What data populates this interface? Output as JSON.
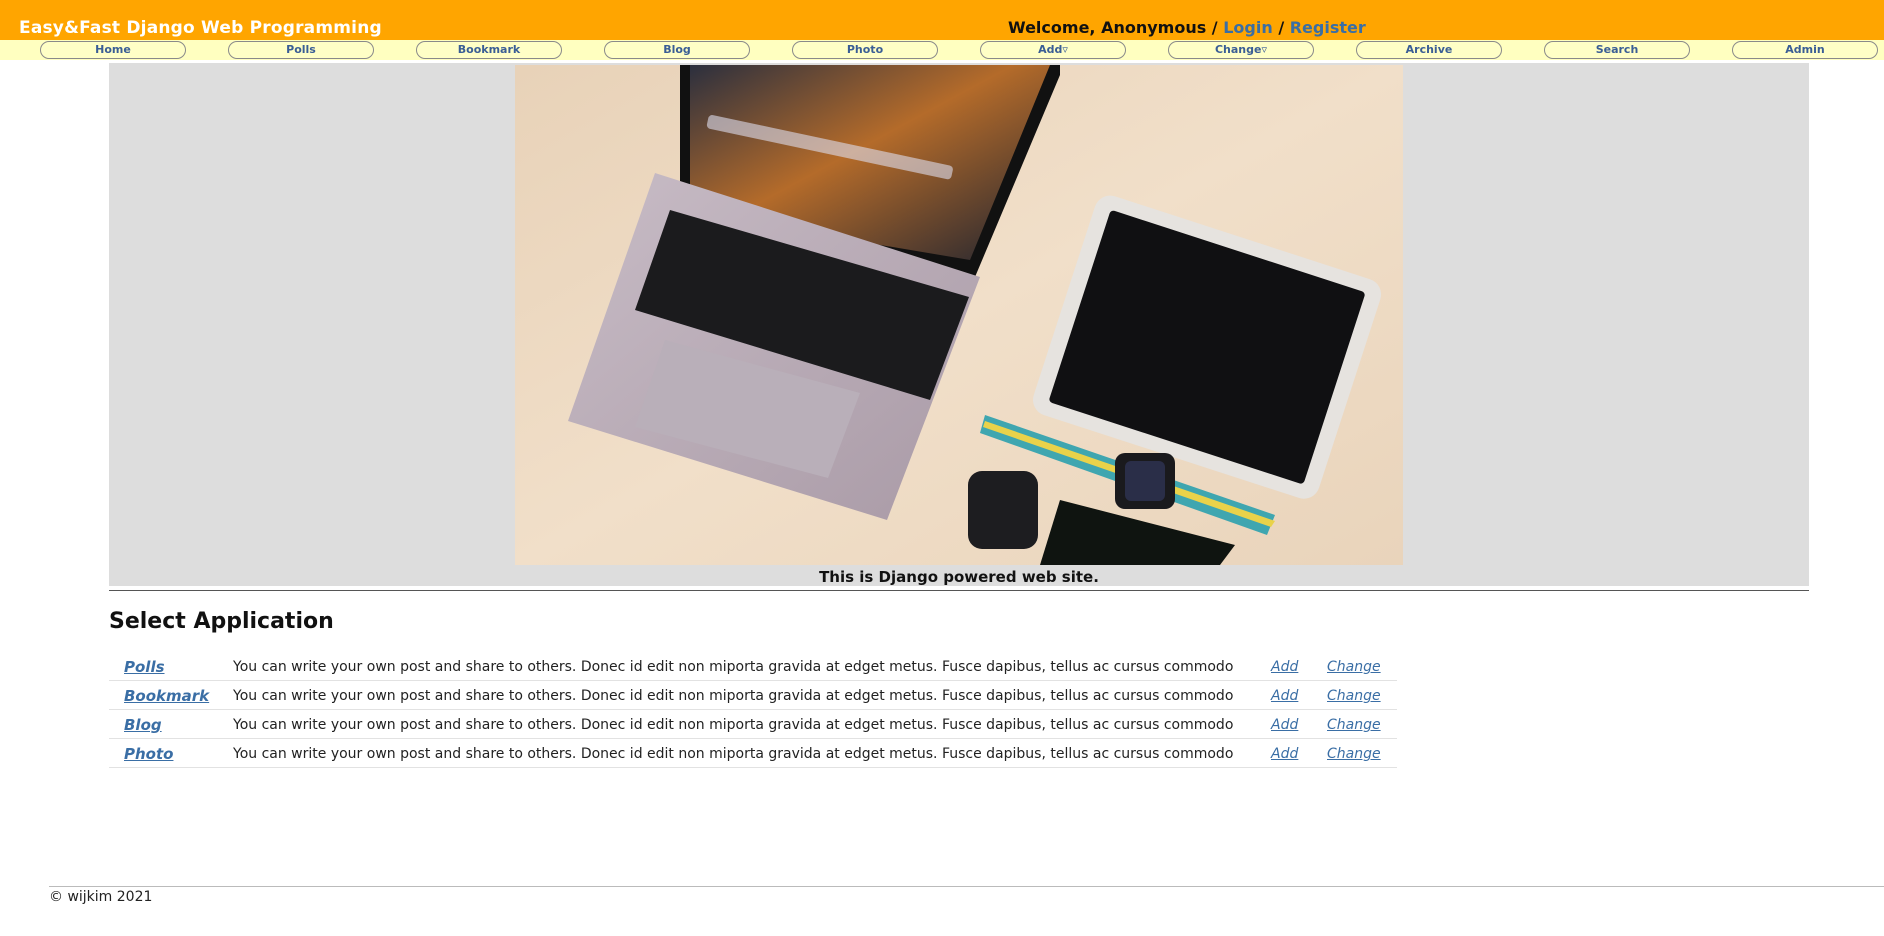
{
  "header": {
    "site_title": "Easy&Fast Django Web Programming",
    "welcome_prefix": "Welcome, Anonymous /",
    "login_label": "Login",
    "separator": "/",
    "register_label": "Register",
    "background_color": "#ffa500"
  },
  "nav": {
    "items": [
      {
        "label": "Home"
      },
      {
        "label": "Polls"
      },
      {
        "label": "Bookmark"
      },
      {
        "label": "Blog"
      },
      {
        "label": "Photo"
      },
      {
        "label": "Add▿"
      },
      {
        "label": "Change▿"
      },
      {
        "label": "Archive"
      },
      {
        "label": "Search"
      },
      {
        "label": "Admin"
      }
    ],
    "background_color": "#ffffc0"
  },
  "hero": {
    "image": "laptop-tablet-desk-photo",
    "caption": "This is Django powered web site."
  },
  "apps": {
    "title": "Select Application",
    "rows": [
      {
        "name": "Polls",
        "description": "You can write your own post and share to others. Donec id edit non miporta gravida at edget metus. Fusce dapibus, tellus ac cursus commodo",
        "add": "Add",
        "change": "Change"
      },
      {
        "name": "Bookmark",
        "description": "You can write your own post and share to others. Donec id edit non miporta gravida at edget metus. Fusce dapibus, tellus ac cursus commodo",
        "add": "Add",
        "change": "Change"
      },
      {
        "name": "Blog",
        "description": "You can write your own post and share to others. Donec id edit non miporta gravida at edget metus. Fusce dapibus, tellus ac cursus commodo",
        "add": "Add",
        "change": "Change"
      },
      {
        "name": "Photo",
        "description": "You can write your own post and share to others. Donec id edit non miporta gravida at edget metus. Fusce dapibus, tellus ac cursus commodo",
        "add": "Add",
        "change": "Change"
      }
    ]
  },
  "footer": {
    "text": "© wijkim 2021"
  }
}
